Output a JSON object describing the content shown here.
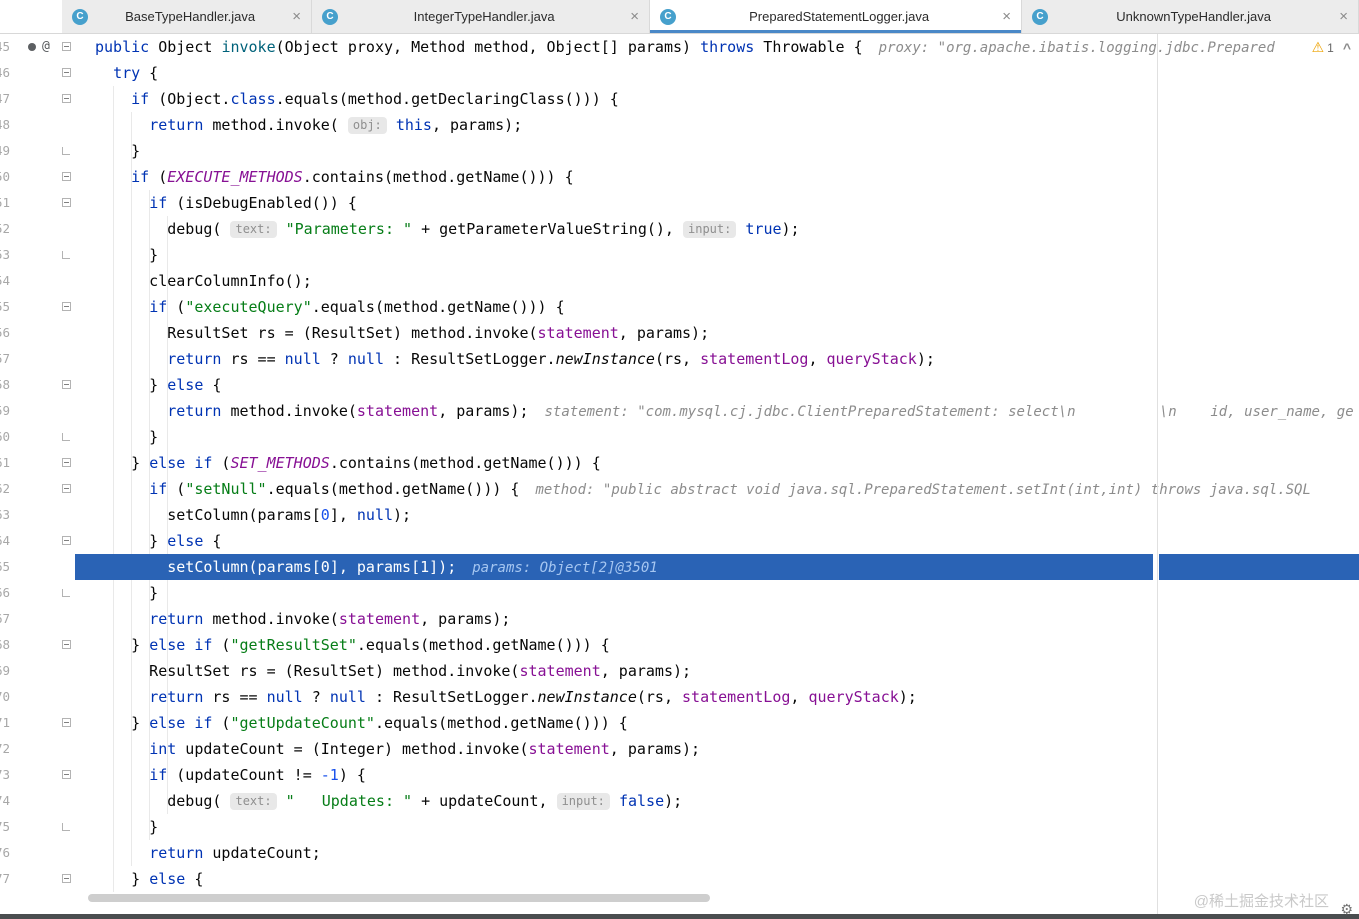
{
  "ui": {
    "class_icon_letter": "C",
    "tab_close_glyph": "×",
    "warning_glyph": "⚠",
    "chevron_glyph": "^",
    "gear_glyph": "⚙"
  },
  "colors": {
    "keyword": "#0033b3",
    "string": "#067d17",
    "number": "#1750eb",
    "field": "#871094",
    "method_declaration": "#00627a",
    "inline_hint": "#8c8c8c",
    "execution_line_background": "#2a63b5",
    "line_number": "#a8a8a8",
    "active_tab_underline": "#4a88c7"
  },
  "tabs": [
    {
      "label": "BaseTypeHandler.java",
      "active": false
    },
    {
      "label": "IntegerTypeHandler.java",
      "active": false
    },
    {
      "label": "PreparedStatementLogger.java",
      "active": true
    },
    {
      "label": "UnknownTypeHandler.java",
      "active": false
    }
  ],
  "editor": {
    "warning_count": "1",
    "first_line_number": "45",
    "lines": [
      {
        "num": "45",
        "fold": "start",
        "icons": [
          "dot",
          "at"
        ],
        "hint": "proxy: \"org.apache.ibatis.logging.jdbc.Prepared",
        "segments": [
          [
            "k",
            "public"
          ],
          [
            "p",
            " Object "
          ],
          [
            "d",
            "invoke"
          ],
          [
            "p",
            "(Object proxy, Method method, Object[] params) "
          ],
          [
            "k",
            "throws"
          ],
          [
            "p",
            " Throwable {"
          ]
        ]
      },
      {
        "num": "46",
        "fold": "start",
        "segments": [
          [
            "p",
            "  "
          ],
          [
            "k",
            "try"
          ],
          [
            "p",
            " {"
          ]
        ]
      },
      {
        "num": "47",
        "fold": "start",
        "segments": [
          [
            "p",
            "    "
          ],
          [
            "k",
            "if"
          ],
          [
            "p",
            " (Object."
          ],
          [
            "k",
            "class"
          ],
          [
            "p",
            ".equals(method.getDeclaringClass())) {"
          ]
        ]
      },
      {
        "num": "48",
        "segments": [
          [
            "p",
            "      "
          ],
          [
            "k",
            "return"
          ],
          [
            "p",
            " method.invoke( "
          ],
          [
            "c",
            "obj:"
          ],
          [
            "p",
            " "
          ],
          [
            "k",
            "this"
          ],
          [
            "p",
            ", params);"
          ]
        ]
      },
      {
        "num": "49",
        "fold": "end",
        "segments": [
          [
            "p",
            "    }"
          ]
        ]
      },
      {
        "num": "50",
        "fold": "start",
        "segments": [
          [
            "p",
            "    "
          ],
          [
            "k",
            "if"
          ],
          [
            "p",
            " ("
          ],
          [
            "sf",
            "EXECUTE_METHODS"
          ],
          [
            "p",
            ".contains(method.getName())) {"
          ]
        ]
      },
      {
        "num": "51",
        "fold": "start",
        "segments": [
          [
            "p",
            "      "
          ],
          [
            "k",
            "if"
          ],
          [
            "p",
            " (isDebugEnabled()) {"
          ]
        ]
      },
      {
        "num": "52",
        "segments": [
          [
            "p",
            "        debug( "
          ],
          [
            "c",
            "text:"
          ],
          [
            "p",
            " "
          ],
          [
            "s",
            "\"Parameters: \""
          ],
          [
            "p",
            " + getParameterValueString(), "
          ],
          [
            "c",
            "input:"
          ],
          [
            "p",
            " "
          ],
          [
            "k",
            "true"
          ],
          [
            "p",
            ");"
          ]
        ]
      },
      {
        "num": "53",
        "fold": "end",
        "segments": [
          [
            "p",
            "      }"
          ]
        ]
      },
      {
        "num": "54",
        "segments": [
          [
            "p",
            "      clearColumnInfo();"
          ]
        ]
      },
      {
        "num": "55",
        "fold": "start",
        "segments": [
          [
            "p",
            "      "
          ],
          [
            "k",
            "if"
          ],
          [
            "p",
            " ("
          ],
          [
            "s",
            "\"executeQuery\""
          ],
          [
            "p",
            ".equals(method.getName())) {"
          ]
        ]
      },
      {
        "num": "56",
        "segments": [
          [
            "p",
            "        ResultSet rs = (ResultSet) method.invoke("
          ],
          [
            "f",
            "statement"
          ],
          [
            "p",
            ", params);"
          ]
        ]
      },
      {
        "num": "57",
        "segments": [
          [
            "p",
            "        "
          ],
          [
            "k",
            "return"
          ],
          [
            "p",
            " rs == "
          ],
          [
            "k",
            "null"
          ],
          [
            "p",
            " ? "
          ],
          [
            "k",
            "null"
          ],
          [
            "p",
            " : ResultSetLogger."
          ],
          [
            "sm",
            "newInstance"
          ],
          [
            "p",
            "(rs, "
          ],
          [
            "f",
            "statementLog"
          ],
          [
            "p",
            ", "
          ],
          [
            "f",
            "queryStack"
          ],
          [
            "p",
            ");"
          ]
        ]
      },
      {
        "num": "58",
        "fold": "start",
        "segments": [
          [
            "p",
            "      } "
          ],
          [
            "k",
            "else"
          ],
          [
            "p",
            " {"
          ]
        ]
      },
      {
        "num": "59",
        "hint": "statement: \"com.mysql.cj.jdbc.ClientPreparedStatement: select\\n          \\n    id, user_name, ge",
        "segments": [
          [
            "p",
            "        "
          ],
          [
            "k",
            "return"
          ],
          [
            "p",
            " method.invoke("
          ],
          [
            "f",
            "statement"
          ],
          [
            "p",
            ", params);"
          ]
        ]
      },
      {
        "num": "60",
        "fold": "end",
        "segments": [
          [
            "p",
            "      }"
          ]
        ]
      },
      {
        "num": "61",
        "fold": "start",
        "segments": [
          [
            "p",
            "    } "
          ],
          [
            "k",
            "else"
          ],
          [
            "p",
            " "
          ],
          [
            "k",
            "if"
          ],
          [
            "p",
            " ("
          ],
          [
            "sf",
            "SET_METHODS"
          ],
          [
            "p",
            ".contains(method.getName())) {"
          ]
        ]
      },
      {
        "num": "62",
        "fold": "start",
        "hint": "method: \"public abstract void java.sql.PreparedStatement.setInt(int,int) throws java.sql.SQL",
        "segments": [
          [
            "p",
            "      "
          ],
          [
            "k",
            "if"
          ],
          [
            "p",
            " ("
          ],
          [
            "s",
            "\"setNull\""
          ],
          [
            "p",
            ".equals(method.getName())) {"
          ]
        ]
      },
      {
        "num": "63",
        "segments": [
          [
            "p",
            "        setColumn(params["
          ],
          [
            "n",
            "0"
          ],
          [
            "p",
            "], "
          ],
          [
            "k",
            "null"
          ],
          [
            "p",
            ");"
          ]
        ]
      },
      {
        "num": "64",
        "fold": "start",
        "segments": [
          [
            "p",
            "      } "
          ],
          [
            "k",
            "else"
          ],
          [
            "p",
            " {"
          ]
        ]
      },
      {
        "num": "65",
        "highlight": true,
        "hint": "params: Object[2]@3501",
        "segments": [
          [
            "p",
            "        setColumn(params["
          ],
          [
            "n",
            "0"
          ],
          [
            "p",
            "], params["
          ],
          [
            "n",
            "1"
          ],
          [
            "p",
            "]);"
          ]
        ]
      },
      {
        "num": "66",
        "fold": "end",
        "segments": [
          [
            "p",
            "      }"
          ]
        ]
      },
      {
        "num": "67",
        "segments": [
          [
            "p",
            "      "
          ],
          [
            "k",
            "return"
          ],
          [
            "p",
            " method.invoke("
          ],
          [
            "f",
            "statement"
          ],
          [
            "p",
            ", params);"
          ]
        ]
      },
      {
        "num": "68",
        "fold": "start",
        "segments": [
          [
            "p",
            "    } "
          ],
          [
            "k",
            "else"
          ],
          [
            "p",
            " "
          ],
          [
            "k",
            "if"
          ],
          [
            "p",
            " ("
          ],
          [
            "s",
            "\"getResultSet\""
          ],
          [
            "p",
            ".equals(method.getName())) {"
          ]
        ]
      },
      {
        "num": "69",
        "segments": [
          [
            "p",
            "      ResultSet rs = (ResultSet) method.invoke("
          ],
          [
            "f",
            "statement"
          ],
          [
            "p",
            ", params);"
          ]
        ]
      },
      {
        "num": "70",
        "segments": [
          [
            "p",
            "      "
          ],
          [
            "k",
            "return"
          ],
          [
            "p",
            " rs == "
          ],
          [
            "k",
            "null"
          ],
          [
            "p",
            " ? "
          ],
          [
            "k",
            "null"
          ],
          [
            "p",
            " : ResultSetLogger."
          ],
          [
            "sm",
            "newInstance"
          ],
          [
            "p",
            "(rs, "
          ],
          [
            "f",
            "statementLog"
          ],
          [
            "p",
            ", "
          ],
          [
            "f",
            "queryStack"
          ],
          [
            "p",
            ");"
          ]
        ]
      },
      {
        "num": "71",
        "fold": "start",
        "segments": [
          [
            "p",
            "    } "
          ],
          [
            "k",
            "else"
          ],
          [
            "p",
            " "
          ],
          [
            "k",
            "if"
          ],
          [
            "p",
            " ("
          ],
          [
            "s",
            "\"getUpdateCount\""
          ],
          [
            "p",
            ".equals(method.getName())) {"
          ]
        ]
      },
      {
        "num": "72",
        "segments": [
          [
            "p",
            "      "
          ],
          [
            "k",
            "int"
          ],
          [
            "p",
            " updateCount = (Integer) method.invoke("
          ],
          [
            "f",
            "statement"
          ],
          [
            "p",
            ", params);"
          ]
        ]
      },
      {
        "num": "73",
        "fold": "start",
        "segments": [
          [
            "p",
            "      "
          ],
          [
            "k",
            "if"
          ],
          [
            "p",
            " (updateCount != "
          ],
          [
            "n",
            "-1"
          ],
          [
            "p",
            ") {"
          ]
        ]
      },
      {
        "num": "74",
        "segments": [
          [
            "p",
            "        debug( "
          ],
          [
            "c",
            "text:"
          ],
          [
            "p",
            " "
          ],
          [
            "s",
            "\"   Updates: \""
          ],
          [
            "p",
            " + updateCount, "
          ],
          [
            "c",
            "input:"
          ],
          [
            "p",
            " "
          ],
          [
            "k",
            "false"
          ],
          [
            "p",
            ");"
          ]
        ]
      },
      {
        "num": "75",
        "fold": "end",
        "segments": [
          [
            "p",
            "      }"
          ]
        ]
      },
      {
        "num": "76",
        "segments": [
          [
            "p",
            "      "
          ],
          [
            "k",
            "return"
          ],
          [
            "p",
            " updateCount;"
          ]
        ]
      },
      {
        "num": "77",
        "fold": "start",
        "segments": [
          [
            "p",
            "    } "
          ],
          [
            "k",
            "else"
          ],
          [
            "p",
            " {"
          ]
        ]
      }
    ]
  },
  "footer": {
    "watermark": "@稀土掘金技术社区"
  }
}
